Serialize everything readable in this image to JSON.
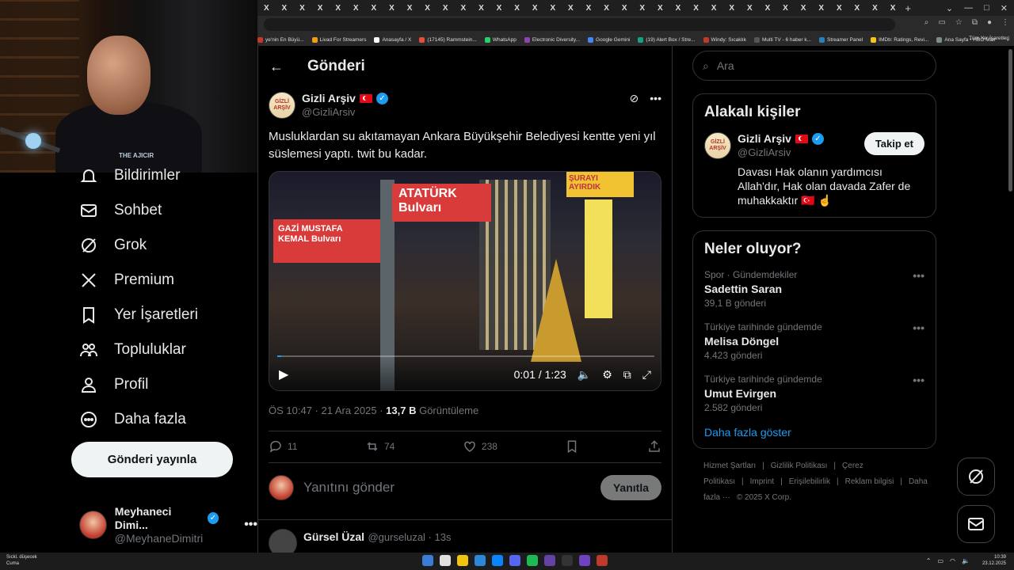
{
  "browser": {
    "tab_glyph": "X",
    "tab_count": 36,
    "new_tab": "+",
    "bookmarks": [
      {
        "label": "ye'nin En Büyü...",
        "color": "#c0392b"
      },
      {
        "label": "Livad For Streamers",
        "color": "#f39c12"
      },
      {
        "label": "Anasayfa / X",
        "color": "#ffffff"
      },
      {
        "label": "(17145) Rammstein...",
        "color": "#e74c3c"
      },
      {
        "label": "WhatsApp",
        "color": "#25d366"
      },
      {
        "label": "Electronic Diversity...",
        "color": "#8e44ad"
      },
      {
        "label": "Google Gemini",
        "color": "#4285f4"
      },
      {
        "label": "(19) Alert Box / Stre...",
        "color": "#16a085"
      },
      {
        "label": "Windy: Sıcaklık",
        "color": "#c0392b"
      },
      {
        "label": "Multi TV - 6 haber k...",
        "color": "#555555"
      },
      {
        "label": "Streamer Panel",
        "color": "#2980b9"
      },
      {
        "label": "IMDb: Ratings, Revi...",
        "color": "#f5c518"
      },
      {
        "label": "Ana Sayfa • HBO Max",
        "color": "#7f8c8d"
      }
    ],
    "bookmarks_more": "»",
    "all_bookmarks": "Tüm Yer İşaretleri"
  },
  "nav": {
    "items": [
      {
        "label": "Bildirimler",
        "icon": "bell-icon"
      },
      {
        "label": "Sohbet",
        "icon": "mail-icon"
      },
      {
        "label": "Grok",
        "icon": "grok-icon"
      },
      {
        "label": "Premium",
        "icon": "x-logo-icon"
      },
      {
        "label": "Yer İşaretleri",
        "icon": "bookmark-icon"
      },
      {
        "label": "Topluluklar",
        "icon": "communities-icon"
      },
      {
        "label": "Profil",
        "icon": "profile-icon"
      },
      {
        "label": "Daha fazla",
        "icon": "more-circle-icon"
      }
    ],
    "post_button": "Gönderi yayınla",
    "account": {
      "name": "Meyhaneci Dimi...",
      "handle": "@MeyhaneDimitri",
      "more": "•••"
    }
  },
  "main": {
    "title": "Gönderi",
    "tweet": {
      "name": "Gizli Arşiv",
      "handle": "@GizliArsiv",
      "avatar_text": "GİZLİ ARŞİV",
      "text": "Musluklardan su akıtamayan Ankara Büyükşehir Belediyesi kentte yeni yıl süslemesi yaptı. twit bu kadar.",
      "video": {
        "sign1": "GAZİ MUSTAFA KEMAL Bulvarı",
        "sign2": "ATATÜRK Bulvarı",
        "billboard": "ŞURAYI AYIRDIK",
        "time": "0:01 / 1:23",
        "progress": 0.01
      },
      "meta_time": "ÖS 10:47 · 21 Ara 2025 · ",
      "views": "13,7 B",
      "views_label": " Görüntüleme",
      "replies": "11",
      "retweets": "74",
      "likes": "238"
    },
    "reply_placeholder": "Yanıtını gönder",
    "reply_button": "Yanıtla",
    "next": {
      "name": "Gürsel Üzal",
      "handle": "@gurseluzal · 13s"
    }
  },
  "right": {
    "search_placeholder": "Ara",
    "related_title": "Alakalı kişiler",
    "person": {
      "name": "Gizli Arşiv",
      "handle": "@GizliArsiv",
      "follow": "Takip et",
      "bio": "Davası Hak olanın yardımcısı Allah'dır, Hak olan davada Zafer de muhakkaktır 🇹🇷 ☝️"
    },
    "trends_title": "Neler oluyor?",
    "trends": [
      {
        "context": "Spor · Gündemdekiler",
        "name": "Sadettin Saran",
        "count": "39,1 B gönderi"
      },
      {
        "context": "Türkiye tarihinde gündemde",
        "name": "Melisa Döngel",
        "count": "4.423 gönderi"
      },
      {
        "context": "Türkiye tarihinde gündemde",
        "name": "Umut Evirgen",
        "count": "2.582 gönderi"
      }
    ],
    "show_more": "Daha fazla göster",
    "footer": [
      "Hizmet Şartları",
      "|",
      "Gizlilik Politikası",
      "|",
      "Çerez Politikası",
      "|",
      "Imprint",
      "|",
      "Erişilebilirlik",
      "|",
      "Reklam bilgisi",
      "|",
      "Daha fazla ···",
      "© 2025 X Corp."
    ]
  },
  "taskbar": {
    "weather_line1": "Sıckl. düşecek",
    "weather_line2": "Cuma",
    "time": "10:39",
    "date": "23.12.2025",
    "app_colors": [
      "#3a7bd5",
      "#e0e0e0",
      "#f1c40f",
      "#2b88d8",
      "#0a84ff",
      "#5865f2",
      "#1db954",
      "#6441a5",
      "#333333",
      "#6f42c1",
      "#c0392b"
    ]
  },
  "webcam": {
    "shirt_text": "THE AJICIR"
  }
}
